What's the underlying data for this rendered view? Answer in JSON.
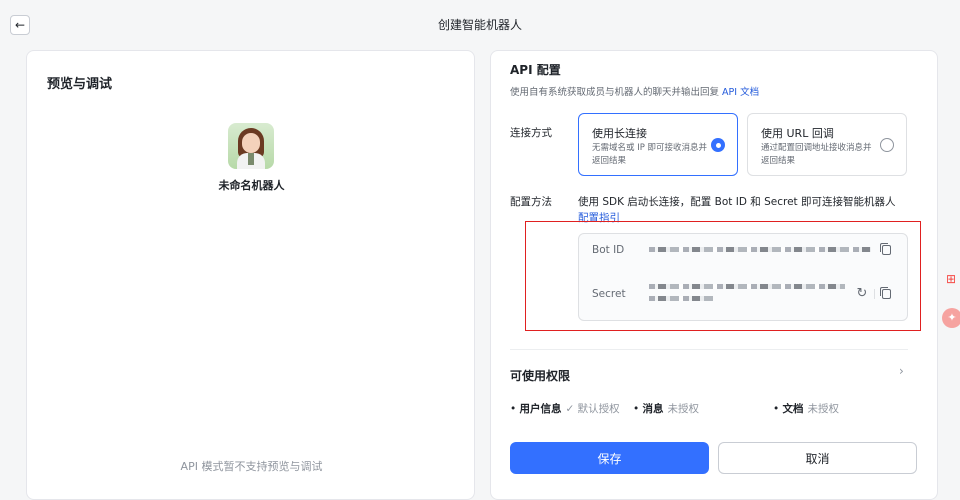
{
  "header": {
    "back_icon": "arrow-left-icon",
    "title": "创建智能机器人"
  },
  "preview": {
    "title": "预览与调试",
    "bot_name": "未命名机器人",
    "footer_note": "API 模式暂不支持预览与调试"
  },
  "api": {
    "title": "API 配置",
    "desc_text": "使用自有系统获取成员与机器人的聊天并输出回复 ",
    "desc_link": "API 文档",
    "connection": {
      "label": "连接方式",
      "options": [
        {
          "title": "使用长连接",
          "desc": "无需域名或 IP 即可接收消息并返回结果",
          "selected": true
        },
        {
          "title": "使用 URL 回调",
          "desc": "通过配置回调地址接收消息并返回结果",
          "selected": false
        }
      ]
    },
    "method": {
      "label": "配置方法",
      "text": "使用 SDK 启动长连接，配置 Bot ID 和 Secret 即可连接智能机器人",
      "link": "配置指引"
    },
    "credentials": {
      "bot_id_label": "Bot ID",
      "secret_label": "Secret"
    }
  },
  "permissions": {
    "title": "可使用权限",
    "items": [
      {
        "dot": "•",
        "name": "用户信息",
        "status": "✓ 默认授权"
      },
      {
        "dot": "•",
        "name": "消息",
        "status": "未授权"
      },
      {
        "dot": "•",
        "name": "文档",
        "status": "未授权"
      }
    ]
  },
  "buttons": {
    "save": "保存",
    "cancel": "取消"
  },
  "colors": {
    "primary": "#3370ff",
    "highlight_frame": "#e02020"
  }
}
